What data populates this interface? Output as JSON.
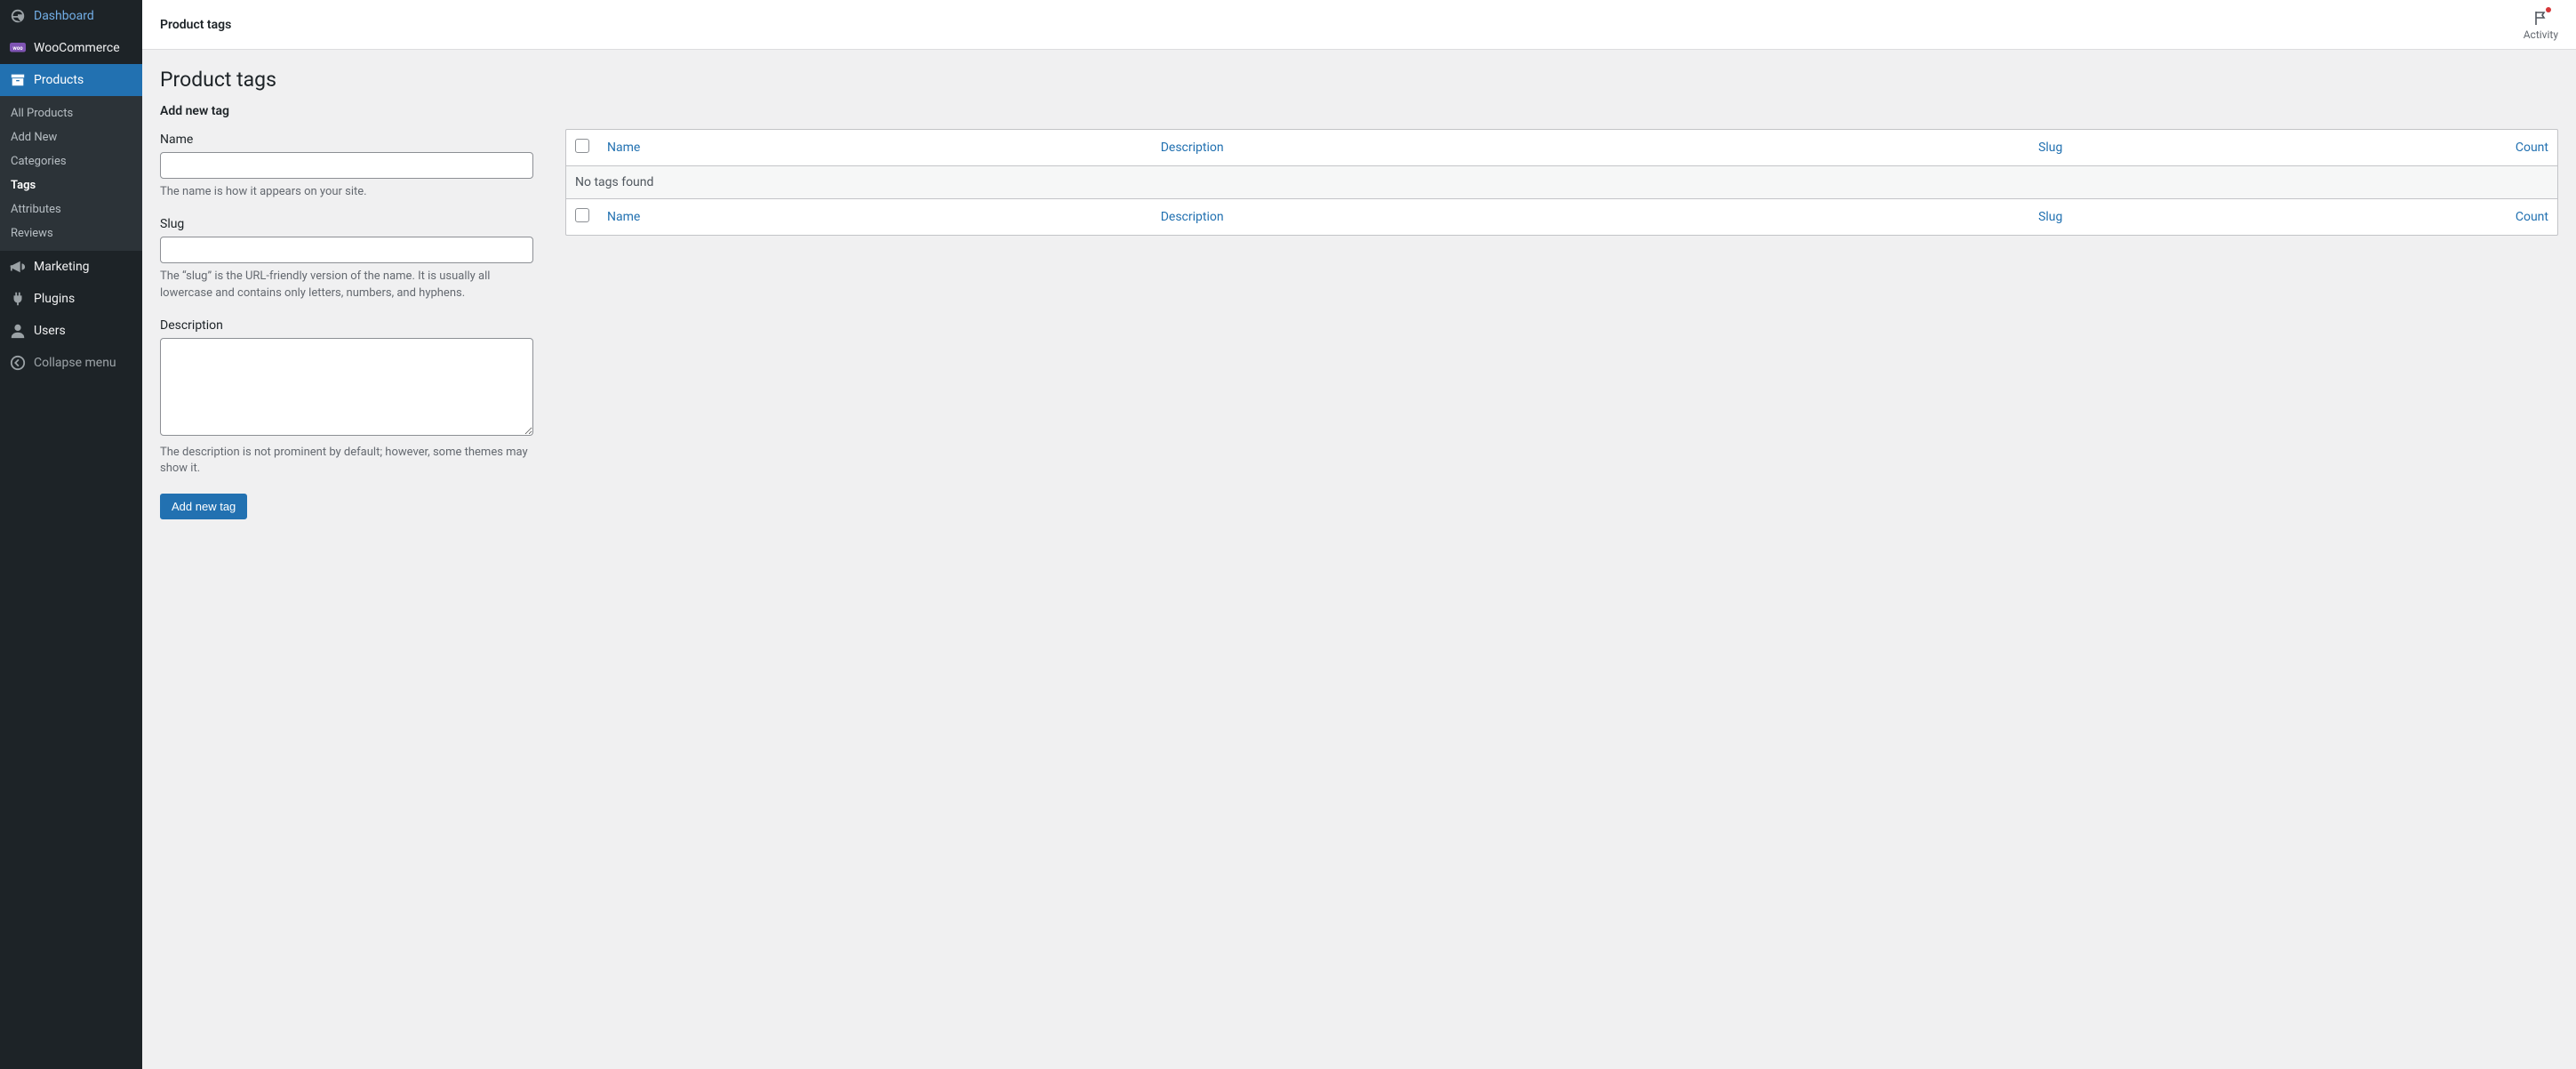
{
  "sidebar": {
    "dashboard": "Dashboard",
    "woocommerce": "WooCommerce",
    "products": "Products",
    "marketing": "Marketing",
    "plugins": "Plugins",
    "users": "Users",
    "collapse": "Collapse menu",
    "sub": {
      "all_products": "All Products",
      "add_new": "Add New",
      "categories": "Categories",
      "tags": "Tags",
      "attributes": "Attributes",
      "reviews": "Reviews"
    }
  },
  "topbar": {
    "title": "Product tags",
    "activity": "Activity"
  },
  "page": {
    "heading": "Product tags"
  },
  "form": {
    "title": "Add new tag",
    "name_label": "Name",
    "name_help": "The name is how it appears on your site.",
    "slug_label": "Slug",
    "slug_help": "The “slug” is the URL-friendly version of the name. It is usually all lowercase and contains only letters, numbers, and hyphens.",
    "desc_label": "Description",
    "desc_help": "The description is not prominent by default; however, some themes may show it.",
    "submit": "Add new tag"
  },
  "table": {
    "cols": {
      "name": "Name",
      "description": "Description",
      "slug": "Slug",
      "count": "Count"
    },
    "empty": "No tags found"
  }
}
